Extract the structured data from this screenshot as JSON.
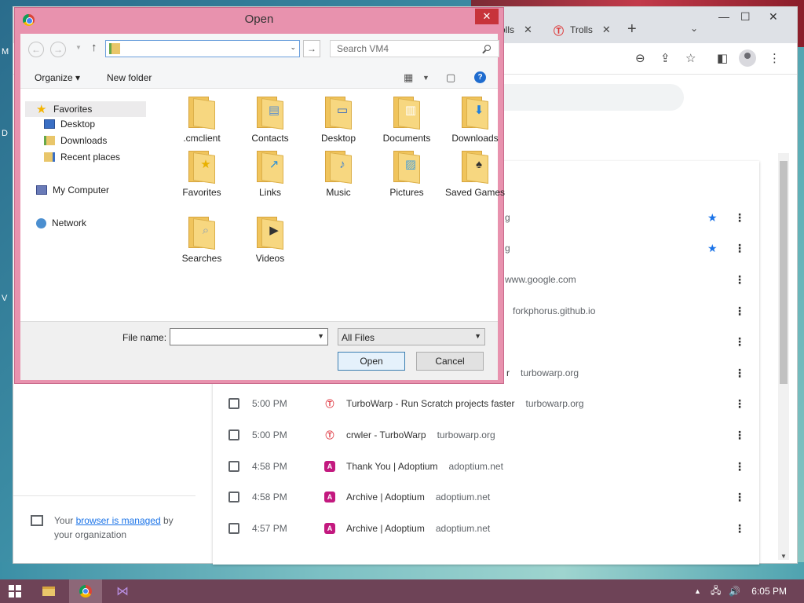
{
  "desktop": {
    "letters": [
      "M",
      "D",
      "V"
    ]
  },
  "chrome": {
    "tabs": [
      {
        "label": "olls"
      },
      {
        "label": "Trolls"
      }
    ],
    "history_rows": [
      {
        "time": "",
        "title": "",
        "domain": "g",
        "starred": true,
        "icon": ""
      },
      {
        "time": "",
        "title": "",
        "domain": "g",
        "starred": true,
        "icon": ""
      },
      {
        "time": "",
        "title": "",
        "domain": "www.google.com",
        "starred": false,
        "icon": ""
      },
      {
        "time": "",
        "title": "",
        "domain": "forkphorus.github.io",
        "starred": false,
        "icon": ""
      },
      {
        "time": "",
        "title": "",
        "domain": "",
        "starred": false,
        "icon": ""
      },
      {
        "time": "",
        "title": "r",
        "domain": "turbowarp.org",
        "starred": false,
        "icon": ""
      },
      {
        "time": "5:00 PM",
        "title": "TurboWarp - Run Scratch projects faster",
        "domain": "turbowarp.org",
        "starred": false,
        "icon": "turbowarp"
      },
      {
        "time": "5:00 PM",
        "title": "crwler - TurboWarp",
        "domain": "turbowarp.org",
        "starred": false,
        "icon": "turbowarp"
      },
      {
        "time": "4:58 PM",
        "title": "Thank You | Adoptium",
        "domain": "adoptium.net",
        "starred": false,
        "icon": "adoptium"
      },
      {
        "time": "4:58 PM",
        "title": "Archive | Adoptium",
        "domain": "adoptium.net",
        "starred": false,
        "icon": "adoptium"
      },
      {
        "time": "4:57 PM",
        "title": "Archive | Adoptium",
        "domain": "adoptium.net",
        "starred": false,
        "icon": "adoptium"
      }
    ],
    "managed": {
      "prefix": "Your ",
      "link": "browser is managed",
      "suffix": " by your organization"
    }
  },
  "dialog": {
    "title": "Open",
    "close_glyph": "✕",
    "search_placeholder": "Search VM4",
    "organize": "Organize",
    "new_folder": "New folder",
    "tree": {
      "favorites": "Favorites",
      "desktop": "Desktop",
      "downloads": "Downloads",
      "recent": "Recent places",
      "computer": "My Computer",
      "network": "Network"
    },
    "files": [
      {
        "name": ".cmclient"
      },
      {
        "name": "Contacts"
      },
      {
        "name": "Desktop"
      },
      {
        "name": "Documents"
      },
      {
        "name": "Downloads"
      },
      {
        "name": "Favorites"
      },
      {
        "name": "Links"
      },
      {
        "name": "Music"
      },
      {
        "name": "Pictures"
      },
      {
        "name": "Saved Games"
      },
      {
        "name": "Searches"
      },
      {
        "name": "Videos"
      }
    ],
    "file_name_label": "File name:",
    "file_name_value": "",
    "filter": "All Files",
    "open_label": "Open",
    "cancel_label": "Cancel"
  },
  "taskbar": {
    "time": "6:05 PM"
  }
}
